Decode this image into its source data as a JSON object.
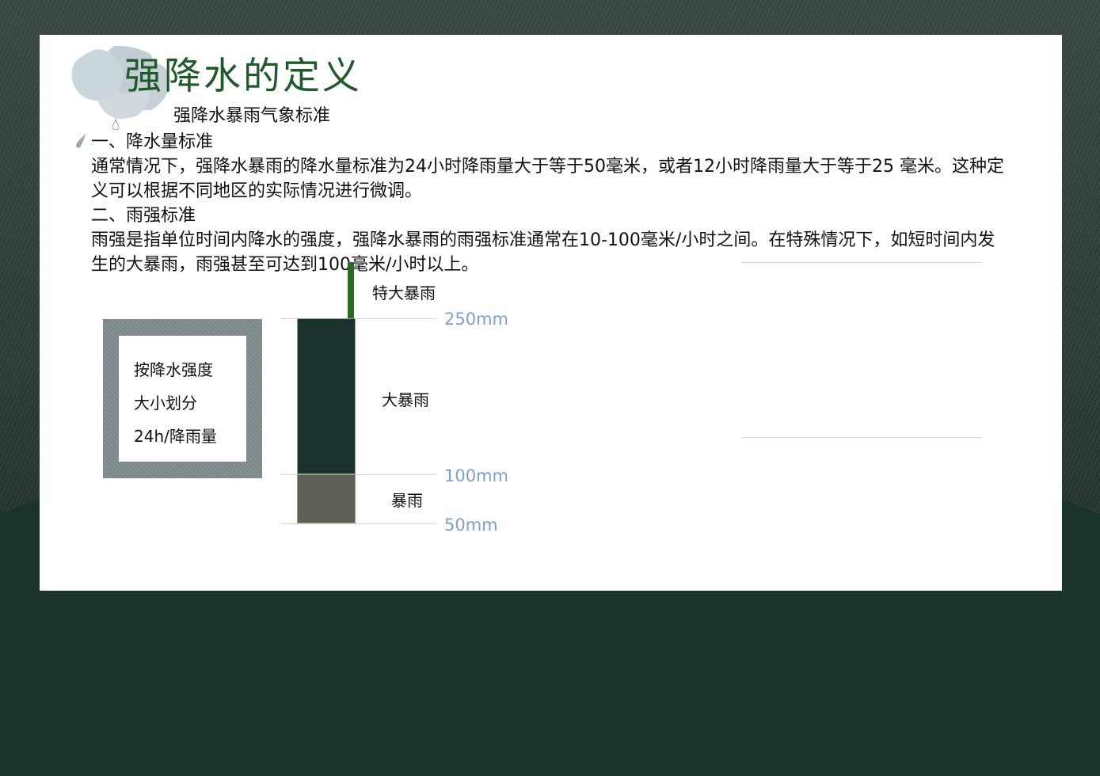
{
  "title": "强降水的定义",
  "subtitle": "强降水暴雨气象标准",
  "sections": [
    {
      "heading": "一、降水量标准",
      "text": "通常情况下，强降水暴雨的降水量标准为24小时降雨量大于等于50毫米，或者12小时降雨量大于等于25 毫米。这种定义可以根据不同地区的实际情况进行微调。"
    },
    {
      "heading": "二、雨强标准",
      "text": "雨强是指单位时间内降水的强度，强降水暴雨的雨强标准通常在10-100毫米/小时之间。在特殊情况下，如短时间内发生的大暴雨，雨强甚至可达到100毫米/小时以上。"
    }
  ],
  "classification_box": {
    "lines": [
      "按降水强度",
      "大小划分",
      "24h/降雨量"
    ]
  },
  "scale": {
    "categories": [
      "特大暴雨",
      "大暴雨",
      "暴雨"
    ],
    "thresholds": [
      "250mm",
      "100mm",
      "50mm"
    ]
  },
  "colors": {
    "title": "#1e5a2a",
    "bar_dark": "#1b332e",
    "bar_gray": "#5e5f57",
    "bar_green": "#2a6a22",
    "threshold_text": "#7d9fd0"
  },
  "icons": [
    "cloud-icon",
    "raindrop-icon"
  ]
}
